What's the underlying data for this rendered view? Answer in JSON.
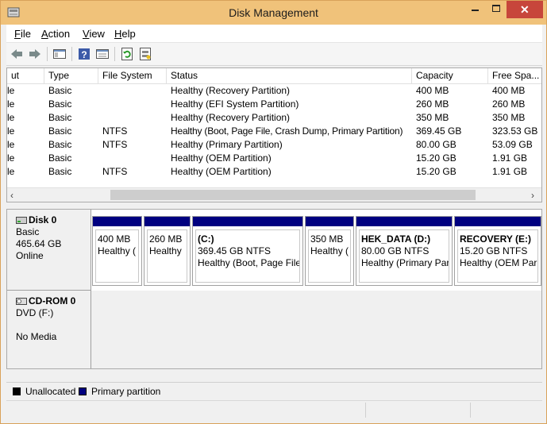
{
  "window": {
    "title": "Disk Management"
  },
  "menu": [
    {
      "label": "File",
      "hotkey": "F",
      "rest": "ile"
    },
    {
      "label": "Action",
      "hotkey": "A",
      "rest": "ction"
    },
    {
      "label": "View",
      "hotkey": "V",
      "rest": "iew"
    },
    {
      "label": "Help",
      "hotkey": "H",
      "rest": "elp"
    }
  ],
  "toolbar": {
    "icons": [
      "back-arrow-icon",
      "forward-arrow-icon",
      "show-hide-console-tree-icon",
      "help-icon",
      "properties-icon",
      "refresh-icon",
      "rescan-disks-icon"
    ]
  },
  "table": {
    "columns": [
      "ut",
      "Type",
      "File System",
      "Status",
      "Capacity",
      "Free Spa..."
    ],
    "rows": [
      {
        "layout": "le",
        "type": "Basic",
        "fs": "",
        "status": "Healthy (Recovery Partition)",
        "capacity": "400 MB",
        "free": "400 MB"
      },
      {
        "layout": "le",
        "type": "Basic",
        "fs": "",
        "status": "Healthy (EFI System Partition)",
        "capacity": "260 MB",
        "free": "260 MB"
      },
      {
        "layout": "le",
        "type": "Basic",
        "fs": "",
        "status": "Healthy (Recovery Partition)",
        "capacity": "350 MB",
        "free": "350 MB"
      },
      {
        "layout": "le",
        "type": "Basic",
        "fs": "NTFS",
        "status": "Healthy (Boot, Page File, Crash Dump, Primary Partition)",
        "capacity": "369.45 GB",
        "free": "323.53 GB"
      },
      {
        "layout": "le",
        "type": "Basic",
        "fs": "NTFS",
        "status": "Healthy (Primary Partition)",
        "capacity": "80.00 GB",
        "free": "53.09 GB"
      },
      {
        "layout": "le",
        "type": "Basic",
        "fs": "",
        "status": "Healthy (OEM Partition)",
        "capacity": "15.20 GB",
        "free": "1.91 GB"
      },
      {
        "layout": "le",
        "type": "Basic",
        "fs": "NTFS",
        "status": "Healthy (OEM Partition)",
        "capacity": "15.20 GB",
        "free": "1.91 GB"
      }
    ]
  },
  "disks": [
    {
      "name": "Disk 0",
      "type": "Basic",
      "size": "465.64 GB",
      "state": "Online"
    },
    {
      "name": "CD-ROM 0",
      "type": "DVD (F:)",
      "size": "",
      "state": "No Media"
    }
  ],
  "partitions": [
    {
      "name": "",
      "line1": "400 MB",
      "line2": "Healthy ("
    },
    {
      "name": "",
      "line1": "260 MB",
      "line2": "Healthy"
    },
    {
      "name": "(C:)",
      "line1": "369.45 GB NTFS",
      "line2": "Healthy (Boot, Page File"
    },
    {
      "name": "",
      "line1": "350 MB",
      "line2": "Healthy ("
    },
    {
      "name": "HEK_DATA  (D:)",
      "line1": "80.00 GB NTFS",
      "line2": "Healthy (Primary Par"
    },
    {
      "name": "RECOVERY  (E:)",
      "line1": "15.20 GB NTFS",
      "line2": "Healthy (OEM Par"
    }
  ],
  "legend": [
    {
      "label": "Unallocated",
      "color": "#000000"
    },
    {
      "label": "Primary partition",
      "color": "#000080"
    }
  ],
  "colors": {
    "title_bar": "#f0c27a",
    "close_button": "#c7463b",
    "partition_bar": "#000080"
  }
}
